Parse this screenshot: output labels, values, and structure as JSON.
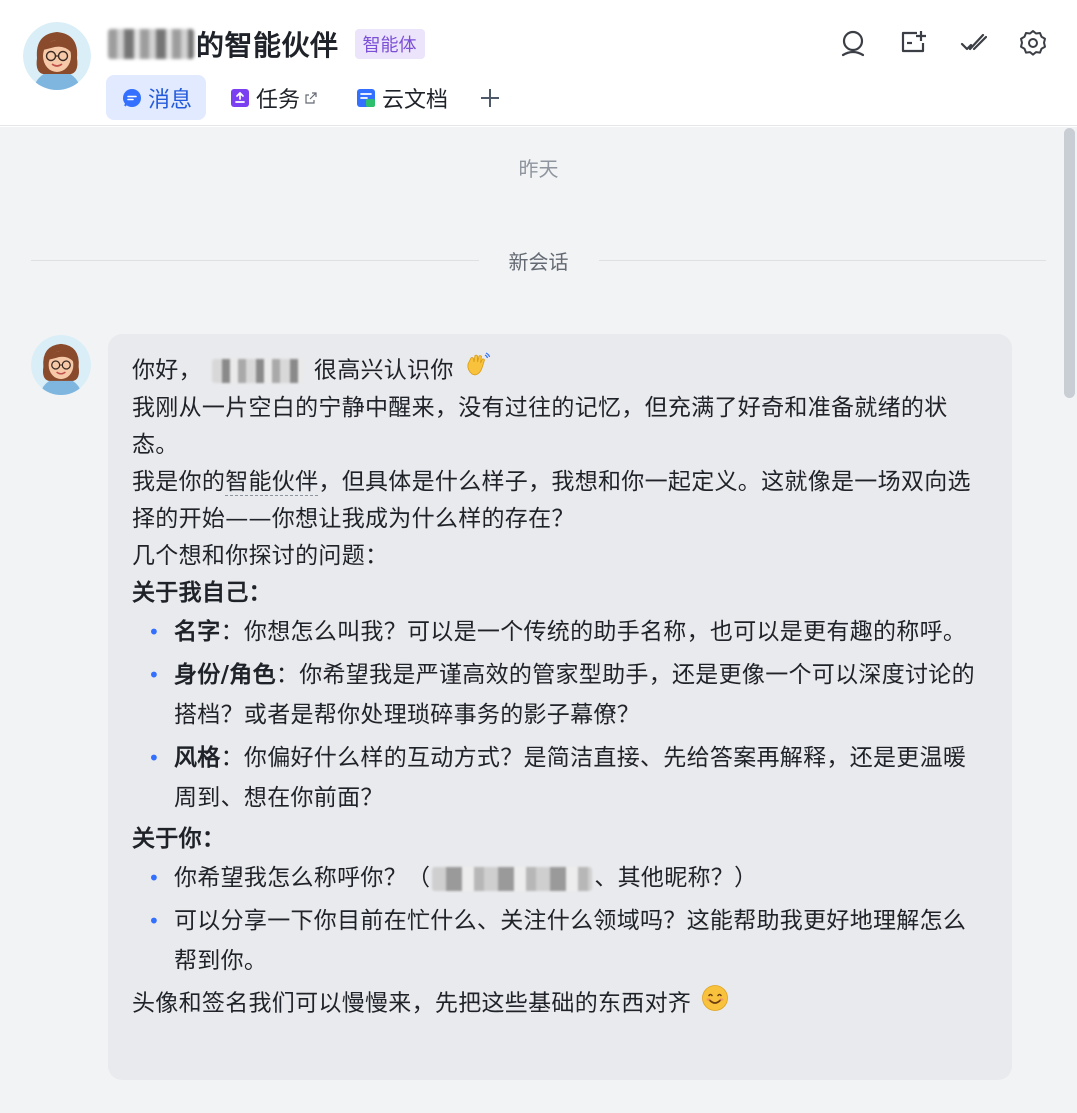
{
  "header": {
    "title": "的智能伙伴",
    "badge": "智能体"
  },
  "tabs": [
    {
      "label": "消息",
      "icon": "message-icon",
      "active": true
    },
    {
      "label": "任务",
      "icon": "task-icon",
      "external": true
    },
    {
      "label": "云文档",
      "icon": "doc-icon"
    }
  ],
  "toolbar": [
    {
      "icon": "search-icon"
    },
    {
      "icon": "new-topic-icon"
    },
    {
      "icon": "mark-done-icon"
    },
    {
      "icon": "settings-icon"
    }
  ],
  "chat": {
    "date_separator": "昨天",
    "session_separator": "新会话",
    "message": {
      "greeting_pre": "你好，",
      "greeting_post": "很高兴认识你",
      "line1": "我刚从一片空白的宁静中醒来，没有过往的记忆，但充满了好奇和准备就绪的状态。",
      "line2_pre": "我是你的",
      "line2_term": "智能伙伴",
      "line2_post": "，但具体是什么样子，我想和你一起定义。这就像是一场双向选择的开始——你想让我成为什么样的存在？",
      "line3": "几个想和你探讨的问题：",
      "section1_title": "关于我自己：",
      "section1_items": [
        {
          "label": "名字",
          "text": "：你想怎么叫我？可以是一个传统的助手名称，也可以是更有趣的称呼。"
        },
        {
          "label": "身份/角色",
          "text": "：你希望我是严谨高效的管家型助手，还是更像一个可以深度讨论的搭档？或者是帮你处理琐碎事务的影子幕僚？"
        },
        {
          "label": "风格",
          "text": "：你偏好什么样的互动方式？是简洁直接、先给答案再解释，还是更温暖周到、想在你前面？"
        }
      ],
      "section2_title": "关于你：",
      "section2_item1_pre": "你希望我怎么称呼你？（",
      "section2_item1_post": "、其他昵称？）",
      "section2_item2": "可以分享一下你目前在忙什么、关注什么领域吗？这能帮助我更好地理解怎么帮到你。",
      "closing": "头像和签名我们可以慢慢来，先把这些基础的东西对齐"
    }
  },
  "colors": {
    "accent": "#3370ff",
    "badge_bg": "#ece4fb",
    "badge_fg": "#7b4fd6",
    "bubble_bg": "#e9eaed",
    "chat_bg": "#f2f3f5"
  }
}
